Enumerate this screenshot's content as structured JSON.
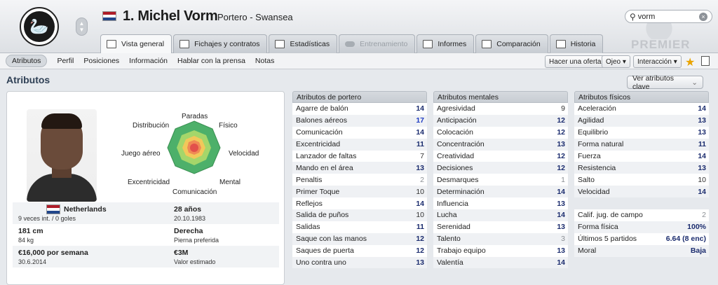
{
  "header": {
    "player_name": "1. Michel Vorm",
    "player_sub": "Portero - Swansea",
    "search_value": "vorm",
    "league_watermark": "PREMIER"
  },
  "tabs": [
    {
      "label": "Vista general",
      "icon": "overview-icon",
      "state": "active"
    },
    {
      "label": "Fichajes y contratos",
      "icon": "document-icon",
      "state": "normal"
    },
    {
      "label": "Estadísticas",
      "icon": "bar-chart-icon",
      "state": "normal"
    },
    {
      "label": "Entrenamiento",
      "icon": "cloud-icon",
      "state": "disabled"
    },
    {
      "label": "Informes",
      "icon": "report-icon",
      "state": "normal"
    },
    {
      "label": "Comparación",
      "icon": "compare-icon",
      "state": "normal"
    },
    {
      "label": "Historia",
      "icon": "history-icon",
      "state": "normal"
    }
  ],
  "subnav": {
    "items": [
      "Atributos",
      "Perfil",
      "Posiciones",
      "Información",
      "Hablar con la prensa",
      "Notas"
    ],
    "active": "Atributos",
    "offer_button": "Hacer una oferta",
    "scout_button": "Ojeo",
    "interaction_button": "Interacción"
  },
  "section": {
    "title": "Atributos",
    "key_button": "Ver atributos clave"
  },
  "radar": {
    "labels": [
      "Paradas",
      "Físico",
      "Velocidad",
      "Mental",
      "Comunicación",
      "Excentricidad",
      "Juego aéreo",
      "Distribución"
    ]
  },
  "profile": {
    "nationality": "Netherlands",
    "caps": "9 veces int. / 0 goles",
    "age": "28 años",
    "dob": "20.10.1983",
    "height": "181 cm",
    "weight": "84 kg",
    "foot": "Derecha",
    "foot_label": "Pierna preferida",
    "wage": "€16,000 por semana",
    "contract": "30.6.2014",
    "value": "€3M",
    "value_label": "Valor estimado"
  },
  "goalkeeping": {
    "title": "Atributos de portero",
    "rows": [
      {
        "name": "Agarre de balón",
        "value": "14"
      },
      {
        "name": "Balones aéreos",
        "value": "17"
      },
      {
        "name": "Comunicación",
        "value": "14"
      },
      {
        "name": "Excentricidad",
        "value": "11"
      },
      {
        "name": "Lanzador de faltas",
        "value": "7"
      },
      {
        "name": "Mando en el área",
        "value": "13"
      },
      {
        "name": "Penaltis",
        "value": "2"
      },
      {
        "name": "Primer Toque",
        "value": "10"
      },
      {
        "name": "Reflejos",
        "value": "14"
      },
      {
        "name": "Salida de puños",
        "value": "10"
      },
      {
        "name": "Salidas",
        "value": "11"
      },
      {
        "name": "Saque con las manos",
        "value": "12"
      },
      {
        "name": "Saques de puerta",
        "value": "12"
      },
      {
        "name": "Uno contra uno",
        "value": "13"
      }
    ]
  },
  "mental": {
    "title": "Atributos mentales",
    "rows": [
      {
        "name": "Agresividad",
        "value": "9"
      },
      {
        "name": "Anticipación",
        "value": "12"
      },
      {
        "name": "Colocación",
        "value": "12"
      },
      {
        "name": "Concentración",
        "value": "13"
      },
      {
        "name": "Creatividad",
        "value": "12"
      },
      {
        "name": "Decisiones",
        "value": "12"
      },
      {
        "name": "Desmarques",
        "value": "1"
      },
      {
        "name": "Determinación",
        "value": "14"
      },
      {
        "name": "Influencia",
        "value": "13"
      },
      {
        "name": "Lucha",
        "value": "14"
      },
      {
        "name": "Serenidad",
        "value": "13"
      },
      {
        "name": "Talento",
        "value": "3"
      },
      {
        "name": "Trabajo equipo",
        "value": "13"
      },
      {
        "name": "Valentía",
        "value": "14"
      }
    ]
  },
  "physical": {
    "title": "Atributos físicos",
    "rows": [
      {
        "name": "Aceleración",
        "value": "14"
      },
      {
        "name": "Agilidad",
        "value": "13"
      },
      {
        "name": "Equilibrio",
        "value": "13"
      },
      {
        "name": "Forma natural",
        "value": "11"
      },
      {
        "name": "Fuerza",
        "value": "14"
      },
      {
        "name": "Resistencia",
        "value": "13"
      },
      {
        "name": "Salto",
        "value": "10"
      },
      {
        "name": "Velocidad",
        "value": "14"
      }
    ],
    "extra": [
      {
        "name": "Calif. jug. de campo",
        "value": "2"
      },
      {
        "name": "Forma física",
        "value": "100%"
      },
      {
        "name": "Últimos 5 partidos",
        "value": "6.64 (8 enc)"
      },
      {
        "name": "Moral",
        "value": "Baja"
      }
    ]
  }
}
